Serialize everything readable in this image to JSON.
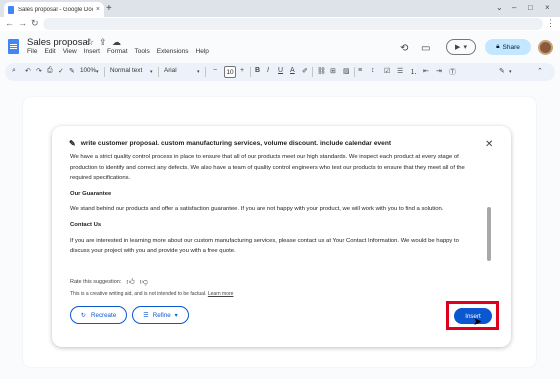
{
  "browser": {
    "tab_title": "Sales proposal - Google Docs",
    "tab_close": "×",
    "new_tab": "+",
    "window_controls": [
      "⌄",
      "–",
      "□",
      "×"
    ]
  },
  "docs": {
    "title": "Sales proposal",
    "menu": [
      "File",
      "Edit",
      "View",
      "Insert",
      "Format",
      "Tools",
      "Extensions",
      "Help"
    ],
    "share_label": "Share"
  },
  "format": {
    "zoom": "100%",
    "style": "Normal text",
    "font": "Arial",
    "font_size": "10"
  },
  "panel": {
    "prompt": "write customer proposal. custom manufacturing services, volume discount. include calendar event",
    "body_p1": "We have a strict quality control process in place to ensure that all of our products meet our high standards. We inspect each product at every stage of production to identify and correct any defects. We also have a team of quality control engineers who test our products to ensure that they meet all of the required specifications.",
    "heading_guarantee": "Our Guarantee",
    "body_guarantee": "We stand behind our products and offer a satisfaction guarantee. If you are not happy with your product, we will work with you to find a solution.",
    "heading_contact": "Contact Us",
    "body_contact": "If you are interested in learning more about our custom manufacturing services, please contact us at Your Contact Information. We would be happy to discuss your project with you and provide you with a free quote.",
    "rate_label": "Rate this suggestion:",
    "disclaimer": "This is a creative writing aid, and is not intended to be factual.",
    "learn_more": "Learn more",
    "recreate_label": "Recreate",
    "refine_label": "Refine",
    "insert_label": "Insert"
  },
  "colors": {
    "accent": "#0b57d0",
    "share_bg": "#c2e7ff",
    "highlight": "#e0001b"
  }
}
